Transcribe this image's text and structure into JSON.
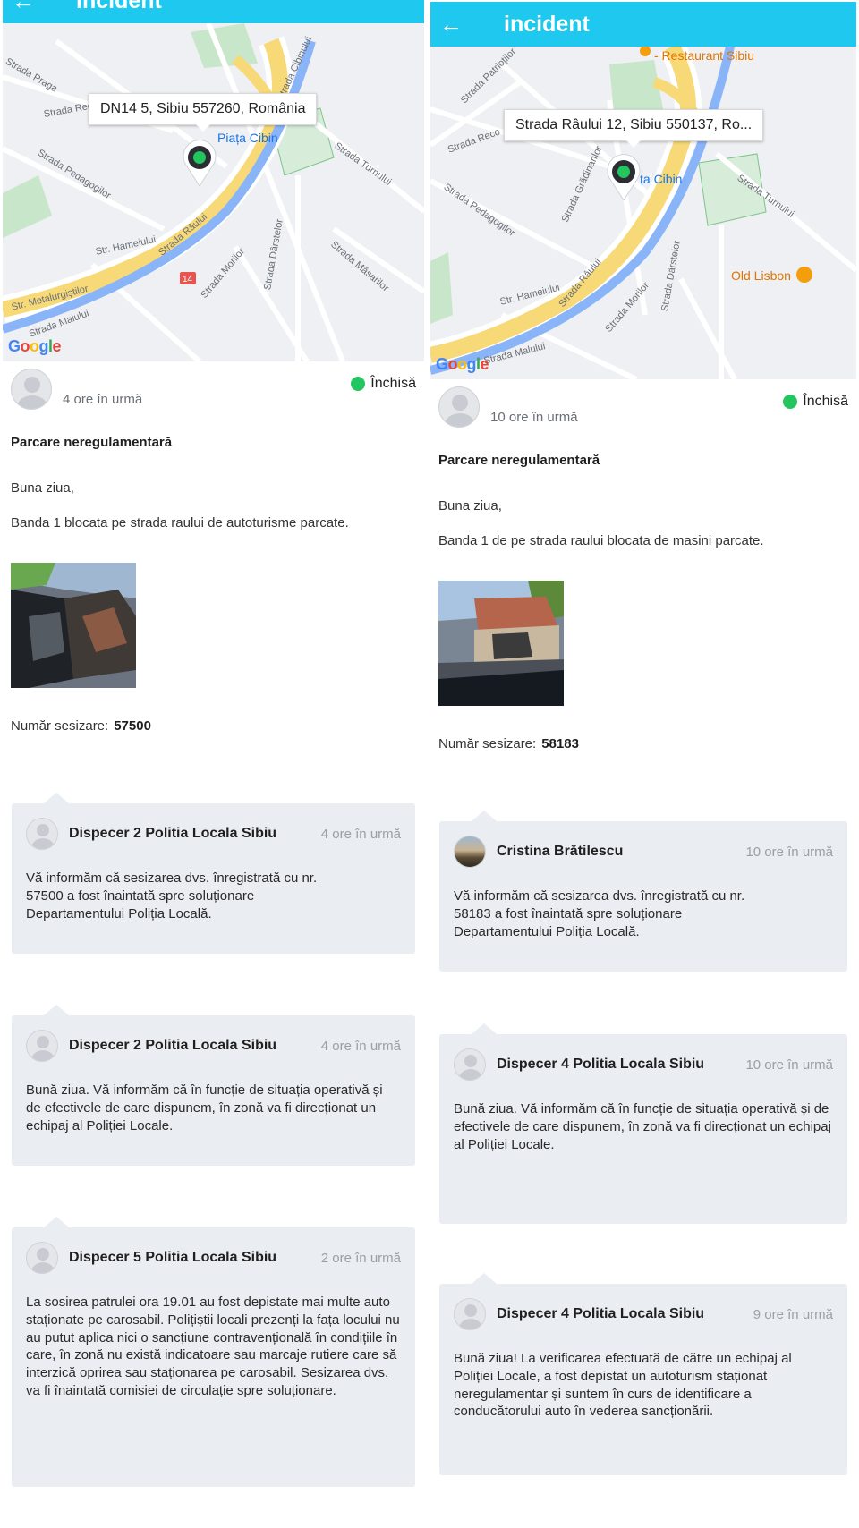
{
  "app": {
    "title": "incident",
    "back_glyph": "←"
  },
  "left": {
    "map": {
      "address": "DN14 5, Sibiu 557260, România",
      "poi": "Piața Cibin",
      "route_badge": "14",
      "google": "Google",
      "streets": [
        "Strada Praga",
        "Strada Reconstrucției",
        "Strada Pedagogilor",
        "Strada Turnului",
        "Str. Hameiului",
        "Strada Râului",
        "Str. Metalurgiștilor",
        "Strada Malului",
        "Strada Morilor",
        "Strada Dârstelor",
        "Strada Măsarilor",
        "Strada Cibinului"
      ]
    },
    "report": {
      "status": "Închisă",
      "time": "4 ore în urmă",
      "title": "Parcare neregulamentară",
      "greeting": "Buna ziua,",
      "text": "Banda 1 blocata pe strada raului de autoturisme parcate.",
      "number_label": "Număr sesizare:",
      "number": "57500"
    },
    "comments": [
      {
        "author": "Dispecer 2 Politia Locala Sibiu",
        "time": "4 ore în urmă",
        "body": "Vă informăm că sesizarea dvs. înregistrată cu nr. 57500 a fost înaintată spre soluționare Departamentului Poliția Locală."
      },
      {
        "author": "Dispecer 2 Politia Locala Sibiu",
        "time": "4 ore în urmă",
        "body": "Bună ziua.  Vă informăm că în funcție de situația operativă și de efectivele de care dispunem, în zonă va fi direcționat un echipaj al Poliției Locale."
      },
      {
        "author": "Dispecer 5 Politia Locala Sibiu",
        "time": "2 ore în urmă",
        "body": "La sosirea patrulei ora 19.01 au fost depistate mai multe auto staționate pe  carosabil. Polițiștii locali prezenți la fața locului nu au putut aplica nici o sancțiune contravențională în condițiile în care, în zonă nu există indicatoare sau marcaje rutiere care să interzică oprirea sau staționarea pe carosabil. Sesizarea dvs. va fi înaintată   comisiei de circulație spre soluționare."
      }
    ]
  },
  "right": {
    "map": {
      "address": "Strada Râului 12, Sibiu 550137, Ro...",
      "poi": "ța Cibin",
      "poi_top": "- Restaurant Sibiu",
      "poi_restaurant": "Old Lisbon",
      "google": "Google",
      "streets": [
        "Strada Patrioților",
        "Strada Reco",
        "Strada Pedagogilor",
        "Strada Grădinarilor",
        "Strada Turnului",
        "Str. Hameiului",
        "Strada Râului",
        "Strada Morilor",
        "Strada Dârstelor",
        "Strada Malului"
      ]
    },
    "report": {
      "status": "Închisă",
      "time": "10 ore în urmă",
      "title": "Parcare neregulamentară",
      "greeting": "Buna ziua,",
      "text": "Banda 1 de pe strada raului blocata de masini parcate.",
      "number_label": "Număr sesizare:",
      "number": "58183"
    },
    "comments": [
      {
        "author": "Cristina Brătilescu",
        "time": "10 ore în urmă",
        "body": "Vă informăm că sesizarea dvs. înregistrată cu nr. 58183 a fost înaintată spre soluționare Departamentului Poliția Locală."
      },
      {
        "author": "Dispecer 4 Politia Locala Sibiu",
        "time": "10 ore în urmă",
        "body": "Bună ziua.  Vă informăm că în funcție de situația operativă și de efectivele de care dispunem, în zonă va fi direcționat un echipaj al Poliției Locale."
      },
      {
        "author": "Dispecer 4 Politia Locala Sibiu",
        "time": "9 ore în urmă",
        "body": "Bună ziua! La verificarea efectuată de către un echipaj al Poliției Locale, a fost depistat un autoturism staționat neregulamentar și suntem în curs de identificare a conducătorului auto în vederea sancționării."
      }
    ]
  },
  "colors": {
    "appbar": "#1ec8ee",
    "status_closed": "#22c55e",
    "comment_bg": "#eaedf2",
    "road_major": "#f7d978",
    "river": "#8ab4f8"
  }
}
